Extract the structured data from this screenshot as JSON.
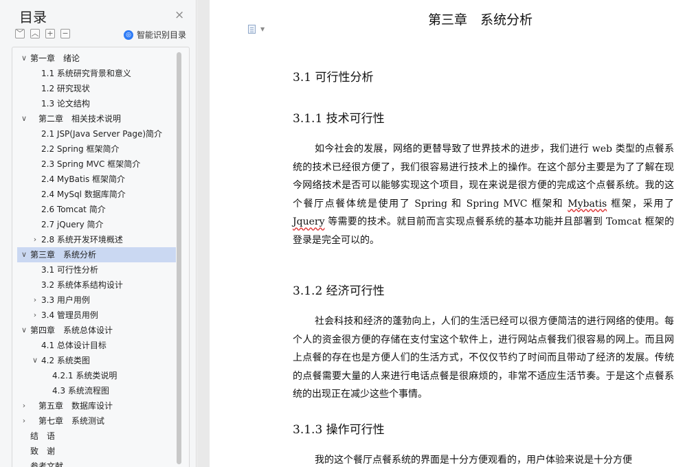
{
  "toc": {
    "title": "目录",
    "close_glyph": "×",
    "toolbar": [
      "﹀",
      "︿",
      "+",
      "−"
    ],
    "smart_label": "智能识别目录",
    "items": [
      {
        "label": "第一章　绪论",
        "expanded": true,
        "has_children": true,
        "level": 1
      },
      {
        "label": "1.1 系统研究背景和意义",
        "level": 2
      },
      {
        "label": "1.2 研究现状",
        "level": 2
      },
      {
        "label": "1.3 论文结构",
        "level": 2
      },
      {
        "label": "第二章　相关技术说明",
        "expanded": true,
        "has_children": true,
        "level": 1
      },
      {
        "label": "2.1 JSP(Java Server Page)简介",
        "level": 2
      },
      {
        "label": "2.2 Spring 框架简介",
        "level": 2
      },
      {
        "label": "2.3 Spring MVC 框架简介",
        "level": 2
      },
      {
        "label": "2.4 MyBatis 框架简介",
        "level": 2
      },
      {
        "label": "2.4 MySql 数据库简介",
        "level": 2
      },
      {
        "label": "2.6 Tomcat 简介",
        "level": 2
      },
      {
        "label": "2.7 jQuery 简介",
        "level": 2
      },
      {
        "label": "2.8 系统开发环境概述",
        "expanded": false,
        "has_children": true,
        "level": 2
      },
      {
        "label": "第三章　系统分析",
        "expanded": true,
        "has_children": true,
        "level": 1,
        "selected": true
      },
      {
        "label": "3.1 可行性分析",
        "level": 2
      },
      {
        "label": "3.2 系统体系结构设计",
        "level": 2
      },
      {
        "label": "3.3 用户用例",
        "expanded": false,
        "has_children": true,
        "level": 2
      },
      {
        "label": "3.4 管理员用例",
        "expanded": false,
        "has_children": true,
        "level": 2
      },
      {
        "label": "第四章　系统总体设计",
        "expanded": true,
        "has_children": true,
        "level": 1
      },
      {
        "label": "4.1 总体设计目标",
        "level": 2
      },
      {
        "label": "4.2 系统类图",
        "expanded": true,
        "has_children": true,
        "level": 2
      },
      {
        "label": "4.2.1 系统类说明",
        "level": 3
      },
      {
        "label": "4.3 系统流程图",
        "level": 3
      },
      {
        "label": "第五章　数据库设计",
        "expanded": false,
        "has_children": true,
        "level": 1
      },
      {
        "label": "第七章　系统测试",
        "expanded": false,
        "has_children": true,
        "level": 1
      },
      {
        "label": "结　语",
        "level": 1
      },
      {
        "label": "致　谢",
        "level": 1
      },
      {
        "label": "参考文献",
        "level": 1
      }
    ]
  },
  "doc": {
    "chapter_title": "第三章　系统分析",
    "h_31": "3.1 可行性分析",
    "h_311": "3.1.1 技术可行性",
    "p_311_a": "如今社会的发展，网络的更替导致了世界技术的进步，我们进行 web 类型的点餐系统的技术已经很方便了，我们很容易进行技术上的操作。在这个部分主要是为了了解在现今网络技术是否可以能够实现这个项目，现在来说是很方便的完成这个点餐系统。我的这个餐厅点餐体统是使用了 Spring  和 Spring MVC 框架和 ",
    "p_311_mybatis": "Mybatis",
    "p_311_b": " 框架，采用了 ",
    "p_311_jquery": "Jquery",
    "p_311_c": " 等需要的技术。就目前而言实现点餐系统的基本功能并且部署到 Tomcat 框架的登录是完全可以的。",
    "h_312": "3.1.2 经济可行性",
    "p_312": "社会科技和经济的蓬勃向上，人们的生活已经可以很方便简洁的进行网络的使用。每个人的资金很方便的存储在支付宝这个软件上，进行网站点餐我们很容易的网上。而且网上点餐的存在也是方便人们的生活方式，不仅仅节约了时间而且带动了经济的发展。传统的点餐需要大量的人来进行电话点餐是很麻烦的，非常不适应生活节奏。于是这个点餐系统的出现正在减少这些个事情。",
    "h_313": "3.1.3 操作可行性",
    "p_313": "我的这个餐厅点餐系统的界面是十分方便观看的，用户体验来说是十分方便"
  }
}
